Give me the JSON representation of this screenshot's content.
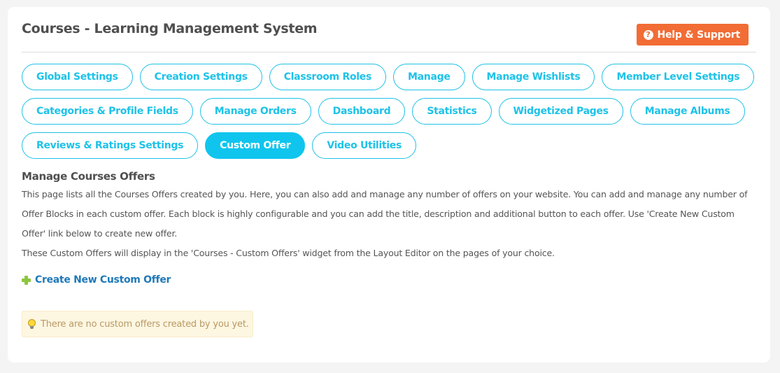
{
  "header": {
    "title": "Courses - Learning Management System",
    "help_button": {
      "label": "Help & Support",
      "icon": "question-circle-icon",
      "color": "#f26c35"
    }
  },
  "tabs": {
    "active": "Custom Offer",
    "accent_color": "#1ec2e8",
    "rows": [
      [
        {
          "label": "Global Settings"
        },
        {
          "label": "Creation Settings"
        },
        {
          "label": "Classroom Roles"
        },
        {
          "label": "Manage"
        },
        {
          "label": "Manage Wishlists"
        },
        {
          "label": "Member Level Settings"
        }
      ],
      [
        {
          "label": "Categories & Profile Fields"
        },
        {
          "label": "Manage Orders"
        },
        {
          "label": "Dashboard"
        },
        {
          "label": "Statistics"
        },
        {
          "label": "Widgetized Pages"
        },
        {
          "label": "Manage Albums"
        }
      ],
      [
        {
          "label": "Reviews & Ratings Settings"
        },
        {
          "label": "Custom Offer"
        },
        {
          "label": "Video Utilities"
        }
      ]
    ]
  },
  "content": {
    "section_title": "Manage Courses Offers",
    "description": [
      "This page lists all the Courses Offers created by you. Here, you can also add and manage any number of offers on your website. You can add and manage any number of Offer Blocks in each custom offer. Each block is highly configurable and you can add the title, description and additional button to each offer. Use 'Create New Custom Offer' link below to create new offer.",
      "These Custom Offers will display in the 'Courses - Custom Offers' widget from the Layout Editor on the pages of your choice."
    ],
    "create_link": {
      "label": "Create New Custom Offer",
      "icon": "plus-icon"
    },
    "notice": {
      "text": "There are no custom offers created by you yet.",
      "icon": "lightbulb-icon"
    }
  }
}
